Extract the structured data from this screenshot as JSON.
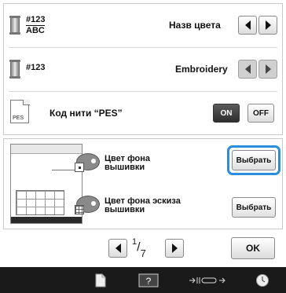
{
  "settings": {
    "row1": {
      "code_top": "#123",
      "code_bottom": "ABC",
      "label": "Назв цвета"
    },
    "row2": {
      "code": "#123",
      "label": "Embroidery"
    },
    "row3": {
      "file_icon_text": "PES",
      "label": "Код нити “PES”",
      "on_label": "ON",
      "off_label": "OFF",
      "state": "ON"
    }
  },
  "background": {
    "embroidery": {
      "label_line1": "Цвет фона",
      "label_line2": "вышивки",
      "button": "Выбрать",
      "focused": true
    },
    "sketch": {
      "label_line1": "Цвет фона эскиза",
      "label_line2": "вышивки",
      "button": "Выбрать"
    }
  },
  "pager": {
    "current": "1",
    "total": "7",
    "ok": "OK"
  },
  "bottom_bar": {
    "icons": [
      "page-icon",
      "help-icon",
      "width-adjust-icon",
      "clock-icon"
    ]
  },
  "colors": {
    "accent": "#2a8fd8",
    "bar": "#1a1a1a",
    "on_button": "#3a3a3a"
  }
}
